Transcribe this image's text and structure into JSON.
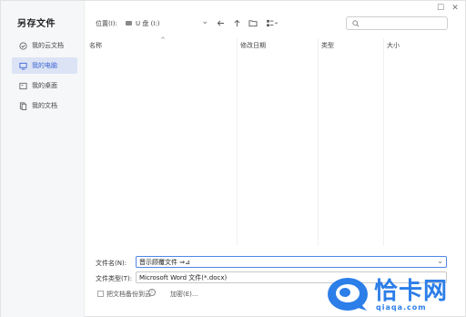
{
  "dialog": {
    "title": "另存文件"
  },
  "sidebar": {
    "items": [
      {
        "label": "我的云文档",
        "icon": "cloud-doc-icon",
        "active": false
      },
      {
        "label": "我的电脑",
        "icon": "monitor-icon",
        "active": true
      },
      {
        "label": "我的桌面",
        "icon": "desktop-icon",
        "active": false
      },
      {
        "label": "我的文档",
        "icon": "documents-icon",
        "active": false
      }
    ]
  },
  "location": {
    "label": "位置(I):",
    "value": "U 盘 (I:)"
  },
  "toolbar": {
    "back_icon": "arrow-left-icon",
    "up_icon": "arrow-up-icon",
    "new_folder_icon": "new-folder-icon",
    "view_icon": "view-mode-icon"
  },
  "search": {
    "placeholder": ""
  },
  "filelist": {
    "columns": [
      "名称",
      "修改日期",
      "类型",
      "大小"
    ],
    "rows": []
  },
  "form": {
    "filename_label": "文件名(N):",
    "filename_value": "晋示顾覆文件 ⇒⊿",
    "filetype_label": "文件类型(T):",
    "filetype_value": "Microsoft Word 文件(*.docx)",
    "backup_label": "把文档备份到云",
    "encrypt_label": "加密(E)..."
  },
  "watermark": {
    "text": "恰卡网",
    "url": "qiaqa.com"
  },
  "colors": {
    "accent": "#3e66d3",
    "selected_bg": "#dbe3f5",
    "watermark": "#2c7ee8"
  }
}
